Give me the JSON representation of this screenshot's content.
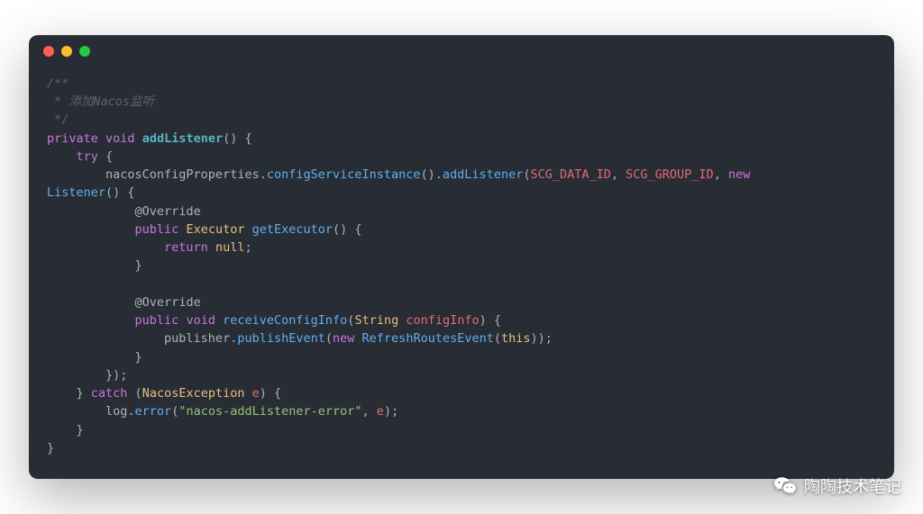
{
  "code": {
    "lines": [
      {
        "segments": [
          {
            "cls": "c-comment",
            "text": "/**"
          }
        ]
      },
      {
        "segments": [
          {
            "cls": "c-comment",
            "text": " * 添加Nacos监听"
          }
        ]
      },
      {
        "segments": [
          {
            "cls": "c-comment",
            "text": " */"
          }
        ]
      },
      {
        "segments": [
          {
            "cls": "c-keyword",
            "text": "private"
          },
          {
            "cls": "",
            "text": " "
          },
          {
            "cls": "c-keyword",
            "text": "void"
          },
          {
            "cls": "",
            "text": " "
          },
          {
            "cls": "c-method-def",
            "text": "addListener"
          },
          {
            "cls": "c-punc",
            "text": "() {"
          }
        ]
      },
      {
        "segments": [
          {
            "cls": "",
            "text": "    "
          },
          {
            "cls": "c-keyword",
            "text": "try"
          },
          {
            "cls": "c-punc",
            "text": " {"
          }
        ]
      },
      {
        "segments": [
          {
            "cls": "",
            "text": "        nacosConfigProperties."
          },
          {
            "cls": "c-method",
            "text": "configServiceInstance"
          },
          {
            "cls": "c-punc",
            "text": "()."
          },
          {
            "cls": "c-method",
            "text": "addListener"
          },
          {
            "cls": "c-punc",
            "text": "("
          },
          {
            "cls": "c-var",
            "text": "SCG_DATA_ID"
          },
          {
            "cls": "c-punc",
            "text": ", "
          },
          {
            "cls": "c-var",
            "text": "SCG_GROUP_ID"
          },
          {
            "cls": "c-punc",
            "text": ", "
          },
          {
            "cls": "c-keyword",
            "text": "new"
          },
          {
            "cls": "",
            "text": " "
          }
        ]
      },
      {
        "segments": [
          {
            "cls": "c-method",
            "text": "Listener"
          },
          {
            "cls": "c-punc",
            "text": "() {"
          }
        ]
      },
      {
        "segments": [
          {
            "cls": "",
            "text": "            "
          },
          {
            "cls": "c-annotation",
            "text": "@Override"
          }
        ]
      },
      {
        "segments": [
          {
            "cls": "",
            "text": "            "
          },
          {
            "cls": "c-keyword",
            "text": "public"
          },
          {
            "cls": "",
            "text": " "
          },
          {
            "cls": "c-class",
            "text": "Executor"
          },
          {
            "cls": "",
            "text": " "
          },
          {
            "cls": "c-method",
            "text": "getExecutor"
          },
          {
            "cls": "c-punc",
            "text": "() {"
          }
        ]
      },
      {
        "segments": [
          {
            "cls": "",
            "text": "                "
          },
          {
            "cls": "c-keyword",
            "text": "return"
          },
          {
            "cls": "",
            "text": " "
          },
          {
            "cls": "c-this",
            "text": "null"
          },
          {
            "cls": "c-punc",
            "text": ";"
          }
        ]
      },
      {
        "segments": [
          {
            "cls": "",
            "text": "            "
          },
          {
            "cls": "c-punc",
            "text": "}"
          }
        ]
      },
      {
        "segments": [
          {
            "cls": "",
            "text": ""
          }
        ]
      },
      {
        "segments": [
          {
            "cls": "",
            "text": "            "
          },
          {
            "cls": "c-annotation",
            "text": "@Override"
          }
        ]
      },
      {
        "segments": [
          {
            "cls": "",
            "text": "            "
          },
          {
            "cls": "c-keyword",
            "text": "public"
          },
          {
            "cls": "",
            "text": " "
          },
          {
            "cls": "c-keyword",
            "text": "void"
          },
          {
            "cls": "",
            "text": " "
          },
          {
            "cls": "c-method",
            "text": "receiveConfigInfo"
          },
          {
            "cls": "c-punc",
            "text": "("
          },
          {
            "cls": "c-class",
            "text": "String"
          },
          {
            "cls": "",
            "text": " "
          },
          {
            "cls": "c-var",
            "text": "configInfo"
          },
          {
            "cls": "c-punc",
            "text": ") {"
          }
        ]
      },
      {
        "segments": [
          {
            "cls": "",
            "text": "                publisher."
          },
          {
            "cls": "c-method",
            "text": "publishEvent"
          },
          {
            "cls": "c-punc",
            "text": "("
          },
          {
            "cls": "c-keyword",
            "text": "new"
          },
          {
            "cls": "",
            "text": " "
          },
          {
            "cls": "c-method",
            "text": "RefreshRoutesEvent"
          },
          {
            "cls": "c-punc",
            "text": "("
          },
          {
            "cls": "c-this",
            "text": "this"
          },
          {
            "cls": "c-punc",
            "text": "));"
          }
        ]
      },
      {
        "segments": [
          {
            "cls": "",
            "text": "            "
          },
          {
            "cls": "c-punc",
            "text": "}"
          }
        ]
      },
      {
        "segments": [
          {
            "cls": "",
            "text": "        "
          },
          {
            "cls": "c-punc",
            "text": "});"
          }
        ]
      },
      {
        "segments": [
          {
            "cls": "",
            "text": "    "
          },
          {
            "cls": "c-punc",
            "text": "} "
          },
          {
            "cls": "c-keyword",
            "text": "catch"
          },
          {
            "cls": "c-punc",
            "text": " ("
          },
          {
            "cls": "c-class",
            "text": "NacosException"
          },
          {
            "cls": "",
            "text": " "
          },
          {
            "cls": "c-var",
            "text": "e"
          },
          {
            "cls": "c-punc",
            "text": ") {"
          }
        ]
      },
      {
        "segments": [
          {
            "cls": "",
            "text": "        log."
          },
          {
            "cls": "c-method",
            "text": "error"
          },
          {
            "cls": "c-punc",
            "text": "("
          },
          {
            "cls": "c-string",
            "text": "\"nacos-addListener-error\""
          },
          {
            "cls": "c-punc",
            "text": ", "
          },
          {
            "cls": "c-var",
            "text": "e"
          },
          {
            "cls": "c-punc",
            "text": ");"
          }
        ]
      },
      {
        "segments": [
          {
            "cls": "",
            "text": "    "
          },
          {
            "cls": "c-punc",
            "text": "}"
          }
        ]
      },
      {
        "segments": [
          {
            "cls": "c-punc",
            "text": "}"
          }
        ]
      }
    ]
  },
  "watermark": {
    "text": "陶陶技术笔记"
  }
}
